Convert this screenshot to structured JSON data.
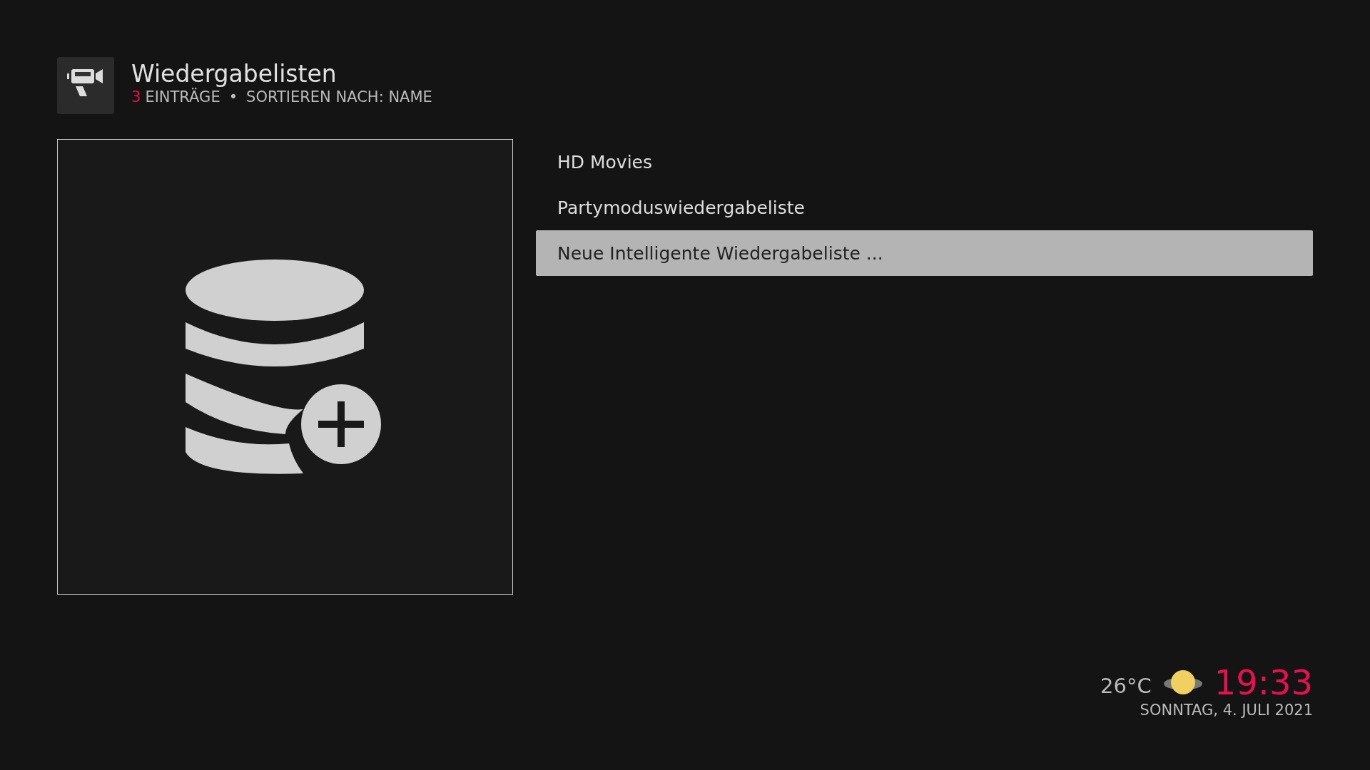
{
  "header": {
    "title": "Wiedergabelisten",
    "count": "3",
    "count_label": "EINTRÄGE",
    "separator": "•",
    "sort": "SORTIEREN NACH: NAME"
  },
  "items": [
    {
      "label": "HD Movies",
      "selected": false
    },
    {
      "label": "Partymoduswiedergabeliste",
      "selected": false
    },
    {
      "label": "Neue Intelligente Wiedergabeliste ...",
      "selected": true
    }
  ],
  "weather": {
    "temperature": "26°C"
  },
  "clock": {
    "time": "19:33",
    "date": "SONNTAG, 4. JULI 2021"
  }
}
